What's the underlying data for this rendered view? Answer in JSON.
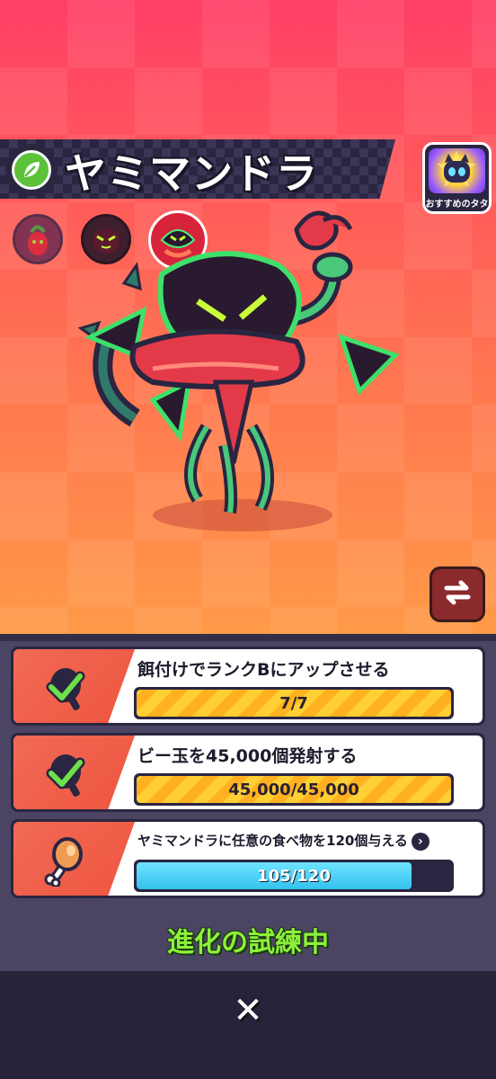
{
  "monster": {
    "name": "ヤミマンドラ",
    "element_icon": "leaf-icon"
  },
  "recommended": {
    "label": "おすすめのタタ",
    "icon": "cat-star-icon"
  },
  "forms": [
    "form-stage-1",
    "form-stage-2",
    "form-stage-3"
  ],
  "tasks": [
    {
      "label": "餌付けでランクBにアップさせる",
      "progress_text": "7/7",
      "progress": 1.0,
      "icon": "checked-meat-icon",
      "complete": true
    },
    {
      "label": "ビー玉を45,000個発射する",
      "progress_text": "45,000/45,000",
      "progress": 1.0,
      "icon": "checked-meat-icon",
      "complete": true
    },
    {
      "label": "ヤミマンドラに任意の食べ物を120個与える",
      "progress_text": "105/120",
      "progress": 0.875,
      "icon": "meat-icon",
      "complete": false
    }
  ],
  "status": "進化の試練中",
  "close_label": "✕",
  "swap_icon": "swap-arrows-icon",
  "colors": {
    "accent_green": "#8df03a",
    "bar_gold": "#ffcf33",
    "bar_blue": "#33c2ee"
  }
}
